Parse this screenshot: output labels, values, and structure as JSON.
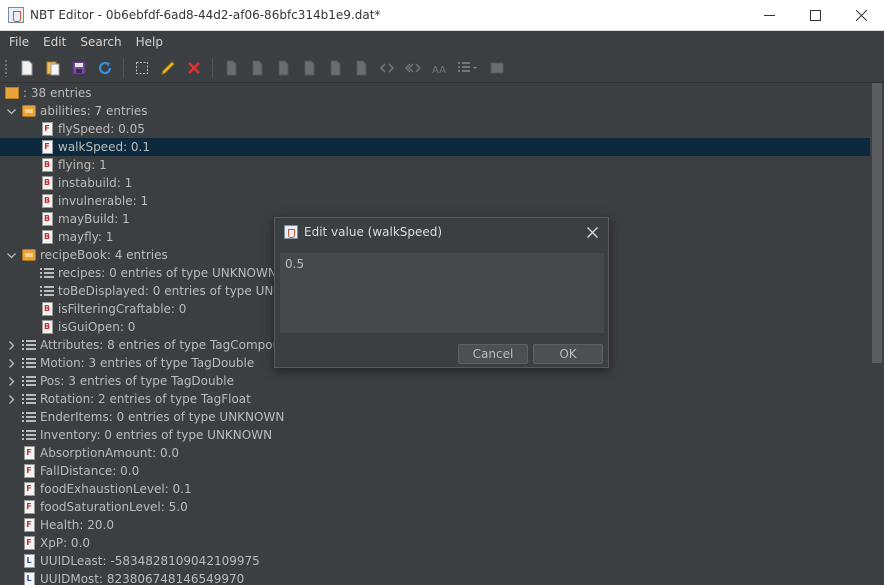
{
  "window": {
    "title": "NBT Editor - 0b6ebfdf-6ad8-44d2-af06-86bfc314b1e9.dat*"
  },
  "menu": [
    "File",
    "Edit",
    "Search",
    "Help"
  ],
  "toolbar": {
    "icons": [
      "new-file-icon",
      "open-file-icon",
      "save-icon",
      "refresh-icon",
      "select-icon",
      "edit-icon",
      "delete-icon",
      "tag-byte-icon",
      "tag-short-icon",
      "tag-int-icon",
      "tag-long-icon",
      "tag-float-icon",
      "tag-double-icon",
      "tag-array-icon",
      "tag-string-icon",
      "tag-list-icon",
      "tag-compound-icon",
      "tag-intarray-icon"
    ]
  },
  "tree": {
    "rows": [
      {
        "indent": 0,
        "expand": "none",
        "icon": "root",
        "label": ": 38 entries"
      },
      {
        "indent": 0,
        "expand": "open",
        "icon": "folder",
        "label": "abilities: 7 entries"
      },
      {
        "indent": 1,
        "expand": "none",
        "icon": "F",
        "label": "flySpeed: 0.05"
      },
      {
        "indent": 1,
        "expand": "none",
        "icon": "F",
        "label": "walkSpeed: 0.1",
        "selected": true
      },
      {
        "indent": 1,
        "expand": "none",
        "icon": "B",
        "label": "flying: 1"
      },
      {
        "indent": 1,
        "expand": "none",
        "icon": "B",
        "label": "instabuild: 1"
      },
      {
        "indent": 1,
        "expand": "none",
        "icon": "B",
        "label": "invulnerable: 1"
      },
      {
        "indent": 1,
        "expand": "none",
        "icon": "B",
        "label": "mayBuild: 1"
      },
      {
        "indent": 1,
        "expand": "none",
        "icon": "B",
        "label": "mayfly: 1"
      },
      {
        "indent": 0,
        "expand": "open",
        "icon": "folder",
        "label": "recipeBook: 4 entries"
      },
      {
        "indent": 1,
        "expand": "none",
        "icon": "list",
        "label": "recipes: 0 entries of type UNKNOWN"
      },
      {
        "indent": 1,
        "expand": "none",
        "icon": "list",
        "label": "toBeDisplayed: 0 entries of type UNKNOWN"
      },
      {
        "indent": 1,
        "expand": "none",
        "icon": "B",
        "label": "isFilteringCraftable: 0"
      },
      {
        "indent": 1,
        "expand": "none",
        "icon": "B",
        "label": "isGuiOpen: 0"
      },
      {
        "indent": 0,
        "expand": "closed",
        "icon": "list",
        "label": "Attributes: 8 entries of type TagCompound"
      },
      {
        "indent": 0,
        "expand": "closed",
        "icon": "list",
        "label": "Motion: 3 entries of type TagDouble"
      },
      {
        "indent": 0,
        "expand": "closed",
        "icon": "list",
        "label": "Pos: 3 entries of type TagDouble"
      },
      {
        "indent": 0,
        "expand": "closed",
        "icon": "list",
        "label": "Rotation: 2 entries of type TagFloat"
      },
      {
        "indent": 0,
        "expand": "none",
        "icon": "list",
        "label": "EnderItems: 0 entries of type UNKNOWN"
      },
      {
        "indent": 0,
        "expand": "none",
        "icon": "list",
        "label": "Inventory: 0 entries of type UNKNOWN"
      },
      {
        "indent": 0,
        "expand": "none",
        "icon": "F",
        "label": "AbsorptionAmount: 0.0"
      },
      {
        "indent": 0,
        "expand": "none",
        "icon": "F",
        "label": "FallDistance: 0.0"
      },
      {
        "indent": 0,
        "expand": "none",
        "icon": "F",
        "label": "foodExhaustionLevel: 0.1"
      },
      {
        "indent": 0,
        "expand": "none",
        "icon": "F",
        "label": "foodSaturationLevel: 5.0"
      },
      {
        "indent": 0,
        "expand": "none",
        "icon": "F",
        "label": "Health: 20.0"
      },
      {
        "indent": 0,
        "expand": "none",
        "icon": "F",
        "label": "XpP: 0.0"
      },
      {
        "indent": 0,
        "expand": "none",
        "icon": "L",
        "label": "UUIDLeast: -5834828109042109975"
      },
      {
        "indent": 0,
        "expand": "none",
        "icon": "L",
        "label": "UUIDMost: 823806748146549970"
      }
    ]
  },
  "dialog": {
    "title": "Edit value (walkSpeed)",
    "value": "0.5",
    "cancel_label": "Cancel",
    "ok_label": "OK"
  }
}
